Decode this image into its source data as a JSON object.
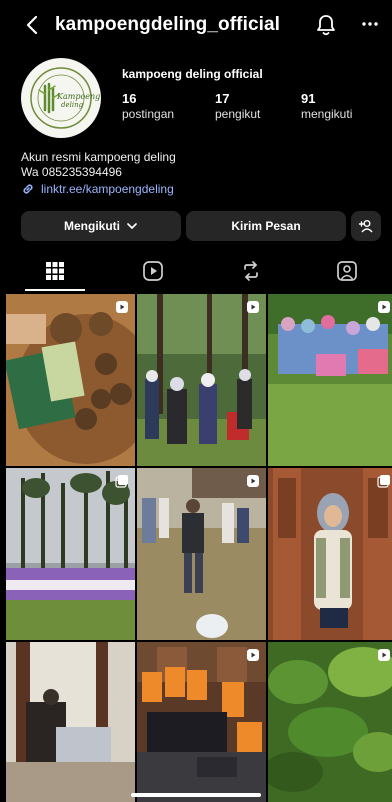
{
  "header": {
    "username": "kampoengdeling_official",
    "back_icon": "chevron-left-icon",
    "notification_icon": "bell-icon",
    "more_icon": "more-dots-icon"
  },
  "profile": {
    "display_name": "kampoeng deling official",
    "avatar_text_top": "Kampoeng",
    "avatar_text_bottom": "deling",
    "stats": [
      {
        "value": "16",
        "label": "postingan"
      },
      {
        "value": "17",
        "label": "pengikut"
      },
      {
        "value": "91",
        "label": "mengikuti"
      }
    ],
    "bio_line1": "Akun resmi kampoeng deling",
    "bio_line2": "Wa 085235394496",
    "link": "linktr.ee/kampoengdeling"
  },
  "actions": {
    "follow_label": "Mengikuti",
    "message_label": "Kirim Pesan",
    "add_user_icon": "add-user-icon"
  },
  "tabs": [
    "grid-icon",
    "reels-icon",
    "repost-icon",
    "tagged-icon"
  ],
  "colors": {
    "background": "#000000",
    "button": "#262626",
    "link": "#9ab6ff"
  },
  "posts": [
    {
      "badge": "reel-icon"
    },
    {
      "badge": "reel-icon"
    },
    {
      "badge": "reel-icon"
    },
    {
      "badge": "carousel-icon"
    },
    {
      "badge": "reel-icon"
    },
    {
      "badge": "carousel-icon"
    },
    {
      "badge": "none"
    },
    {
      "badge": "reel-icon"
    },
    {
      "badge": "reel-icon"
    }
  ]
}
